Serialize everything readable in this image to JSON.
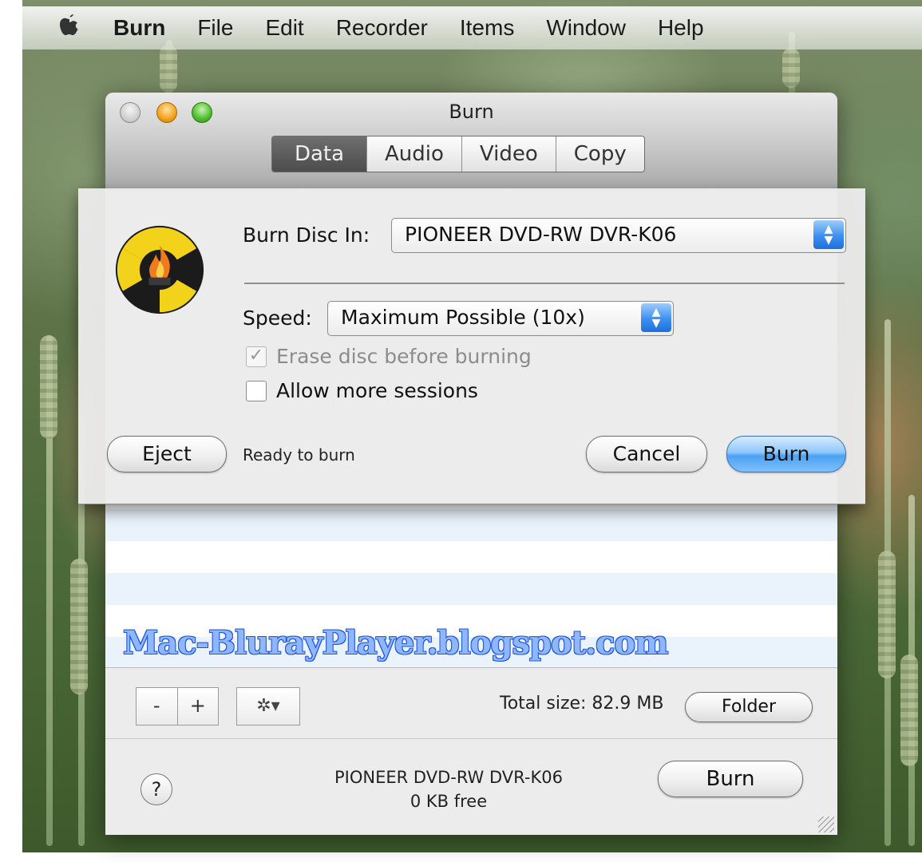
{
  "menubar": {
    "apple": "",
    "items": [
      "Burn",
      "File",
      "Edit",
      "Recorder",
      "Items",
      "Window",
      "Help"
    ]
  },
  "window": {
    "title": "Burn",
    "tabs": [
      "Data",
      "Audio",
      "Video",
      "Copy"
    ],
    "active_tab": "Data"
  },
  "watermark": "Mac-BlurayPlayer.blogspot.com",
  "bottom_toolbar": {
    "remove_label": "-",
    "add_label": "+",
    "action_label": "✲▾",
    "total_size": "Total size: 82.9 MB",
    "folder_label": "Folder",
    "help_label": "?",
    "drive_name": "PIONEER DVD-RW DVR-K06",
    "drive_free": "0 KB free",
    "burn_label": "Burn"
  },
  "sheet": {
    "burn_disc_in_label": "Burn Disc In:",
    "burn_disc_in_value": "PIONEER DVD-RW DVR-K06",
    "speed_label": "Speed:",
    "speed_value": "Maximum Possible (10x)",
    "erase_label": "Erase disc before burning",
    "erase_checked": true,
    "sessions_label": "Allow more sessions",
    "sessions_checked": false,
    "eject_label": "Eject",
    "status": "Ready to burn",
    "cancel_label": "Cancel",
    "burn_label": "Burn"
  },
  "colors": {
    "accent_blue": "#4aa2f2",
    "watermark": "#8fb7ff",
    "logo_yellow": "#f3d21b"
  }
}
